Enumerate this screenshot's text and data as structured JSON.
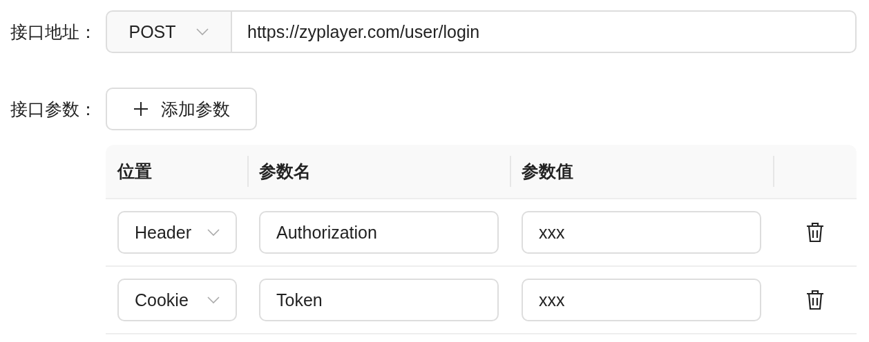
{
  "url_row": {
    "label": "接口地址：",
    "method": "POST",
    "url": "https://zyplayer.com/user/login"
  },
  "params_row": {
    "label": "接口参数：",
    "add_button": "添加参数"
  },
  "table": {
    "columns": [
      "位置",
      "参数名",
      "参数值"
    ],
    "rows": [
      {
        "position": "Header",
        "name": "Authorization",
        "value": "xxx"
      },
      {
        "position": "Cookie",
        "name": "Token",
        "value": "xxx"
      }
    ]
  }
}
